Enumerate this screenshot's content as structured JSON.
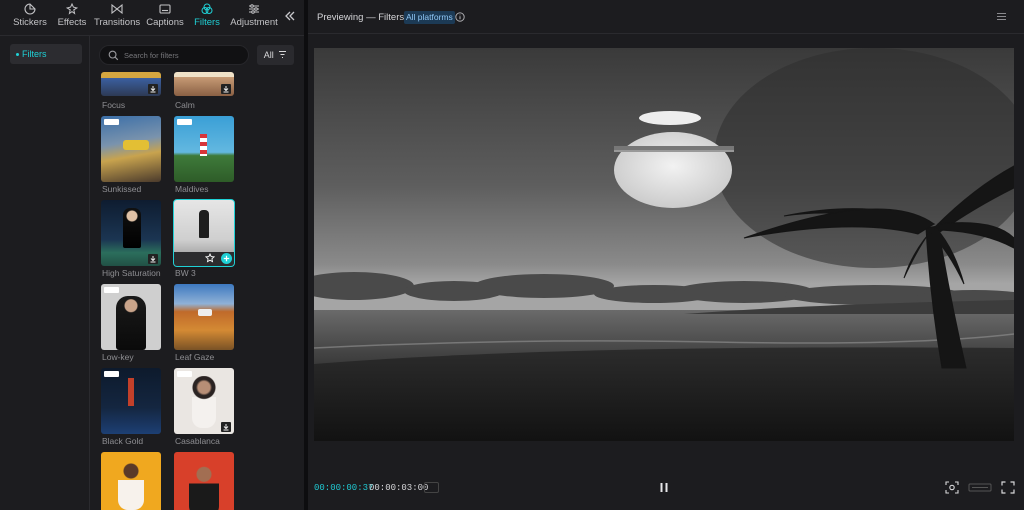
{
  "nav_tabs": [
    {
      "label": "Stickers",
      "icon": "sticker-icon"
    },
    {
      "label": "Effects",
      "icon": "sparkle-icon"
    },
    {
      "label": "Transitions",
      "icon": "bowtie-icon"
    },
    {
      "label": "Captions",
      "icon": "caption-icon"
    },
    {
      "label": "Filters",
      "icon": "filters-icon",
      "active": true
    },
    {
      "label": "Adjustment",
      "icon": "sliders-icon"
    }
  ],
  "collapse_icon": "double-chevron-left-icon",
  "sidebar": {
    "items": [
      {
        "label": "Filters"
      }
    ]
  },
  "search": {
    "placeholder": "Search for filters"
  },
  "filter_button": {
    "label": "All"
  },
  "filters": [
    {
      "name": "Focus"
    },
    {
      "name": "Calm"
    },
    {
      "name": "Sunkissed",
      "tag": true
    },
    {
      "name": "Maldives",
      "tag": true
    },
    {
      "name": "High Saturation"
    },
    {
      "name": "BW 3",
      "selected": true
    },
    {
      "name": "Low-key",
      "tag": true
    },
    {
      "name": "Leaf Gaze"
    },
    {
      "name": "Black Gold",
      "tag": true
    },
    {
      "name": "Casablanca",
      "tag": true
    },
    {
      "name": ""
    },
    {
      "name": ""
    }
  ],
  "preview": {
    "title": "Previewing — Filters",
    "badge": "All platforms",
    "current_time": "00:00:00:37",
    "total_time": "00:00:03:00"
  },
  "colors": {
    "accent": "#1fd1d6",
    "panel": "#1c1c1f",
    "timecode": "#20c7d0"
  }
}
